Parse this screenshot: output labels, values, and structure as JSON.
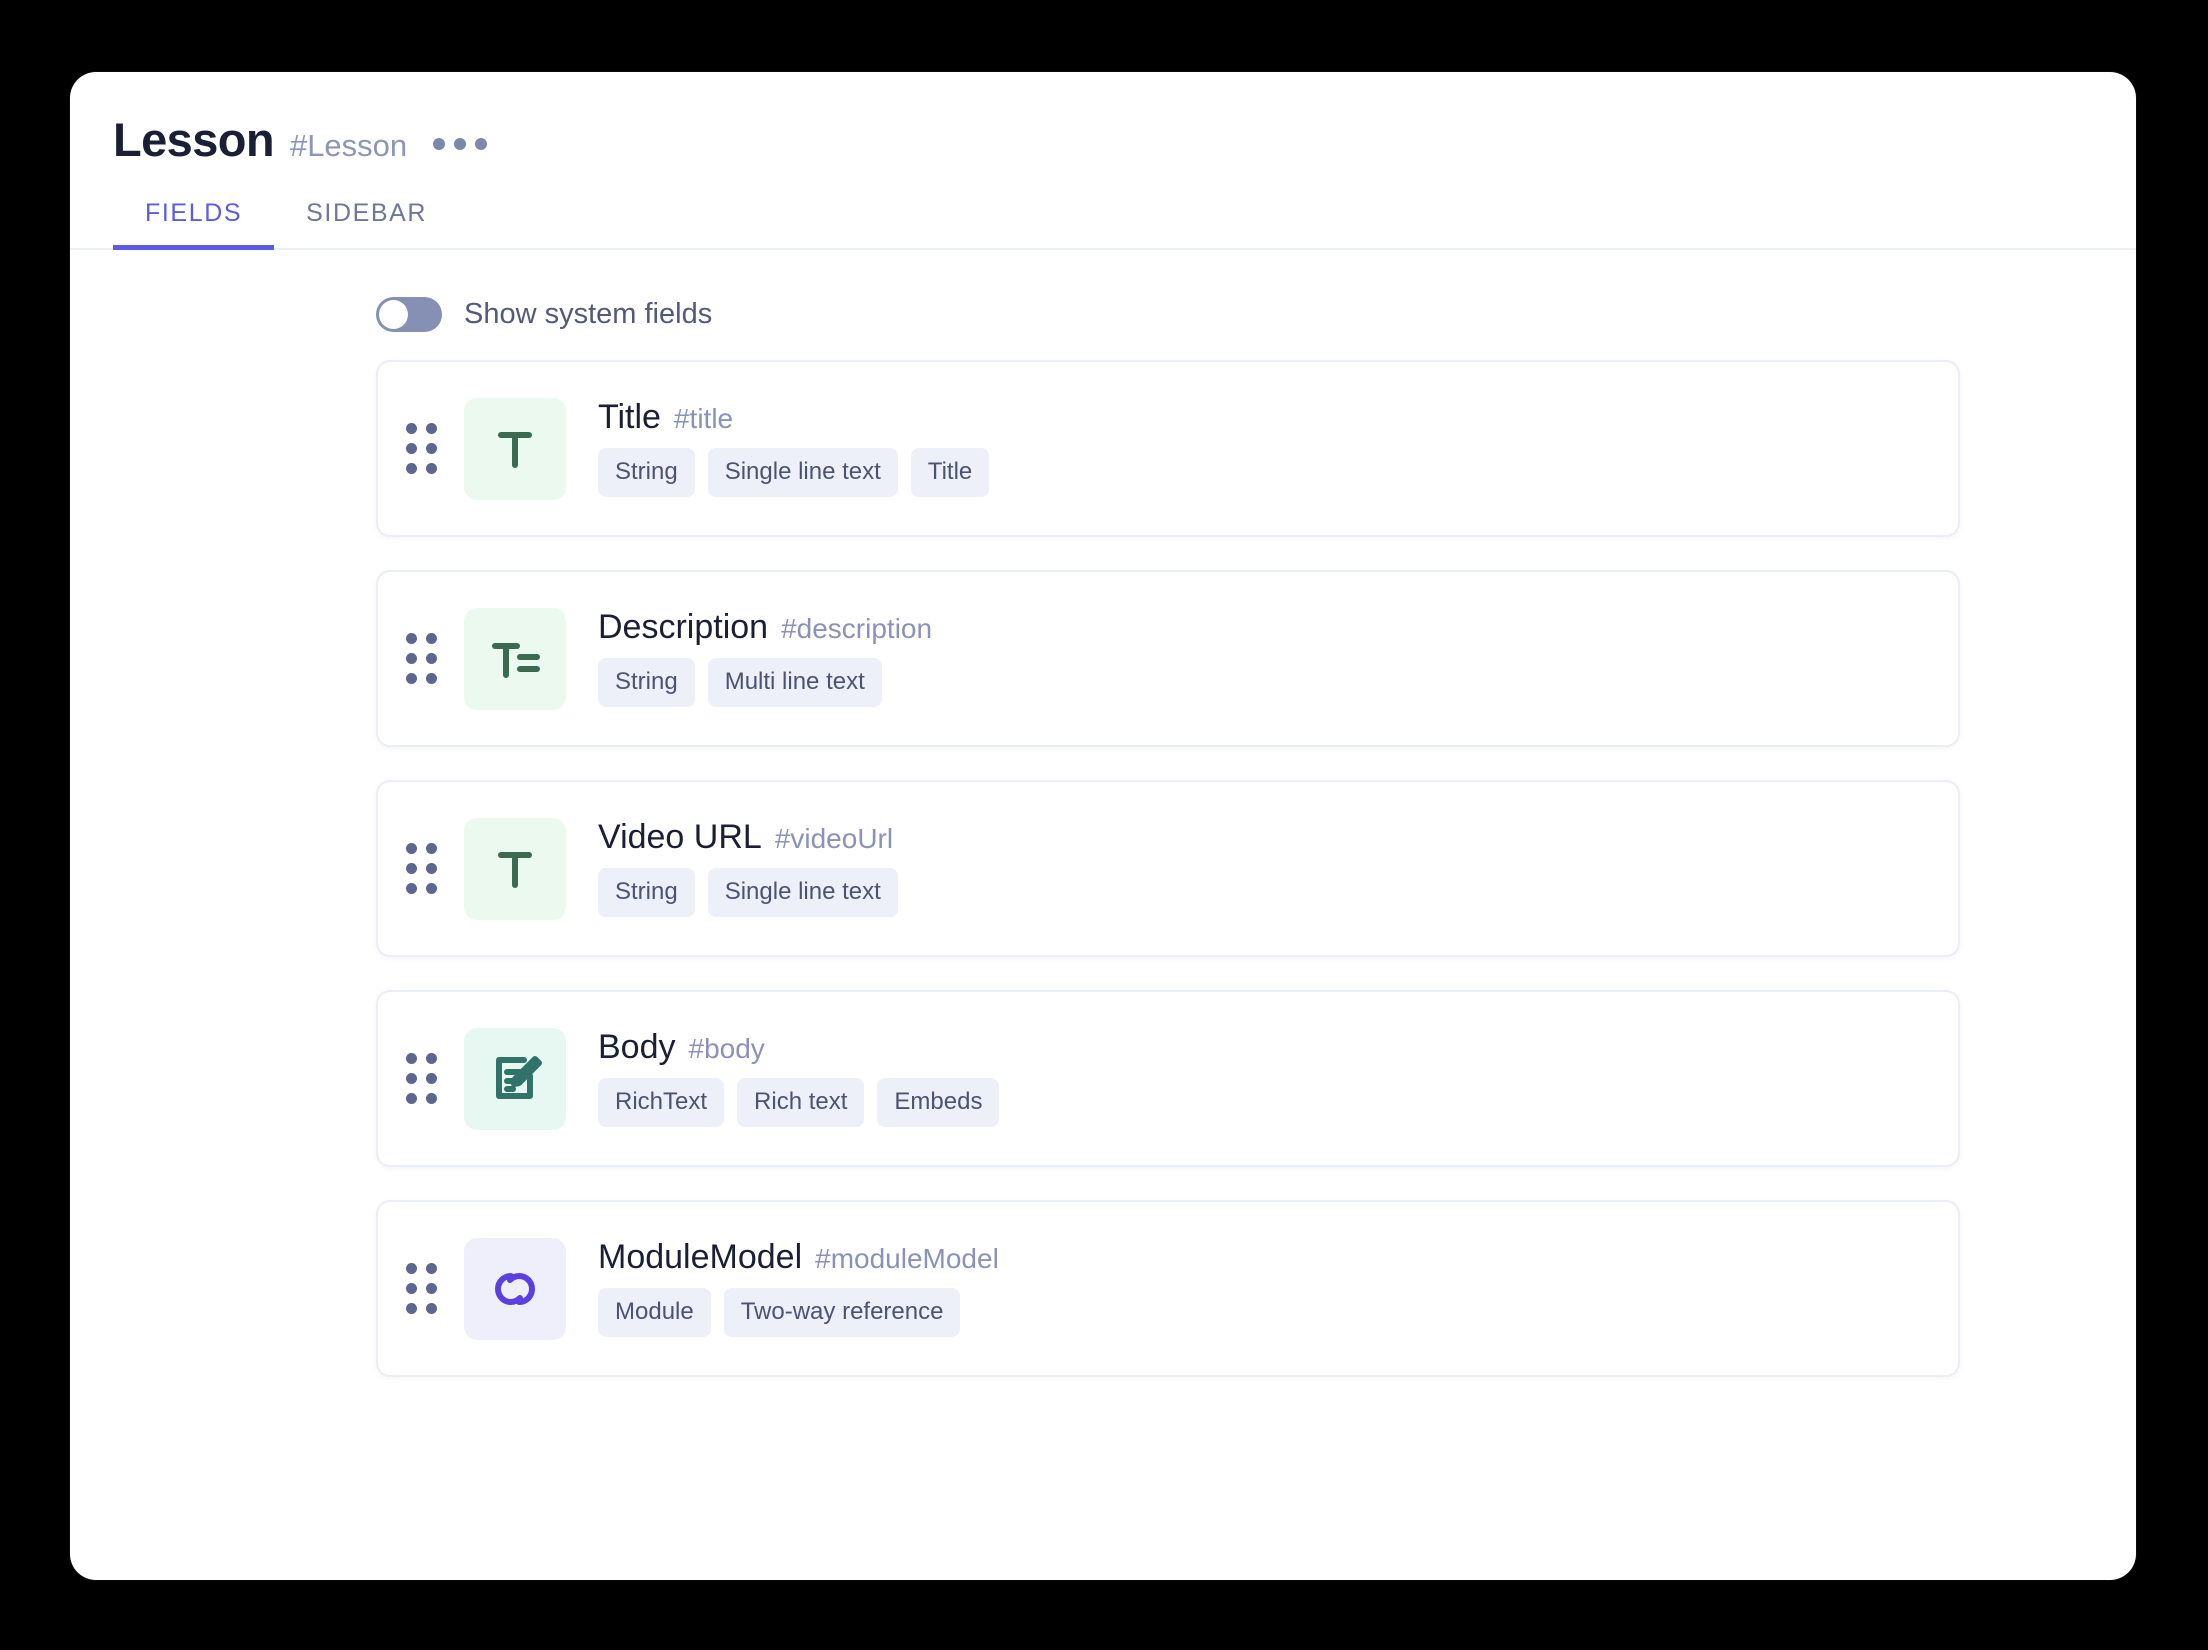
{
  "header": {
    "title": "Lesson",
    "slug": "#Lesson",
    "menu_icon": "kebab-menu-icon"
  },
  "tabs": [
    {
      "label": "FIELDS",
      "active": true
    },
    {
      "label": "SIDEBAR",
      "active": false
    }
  ],
  "controls": {
    "system_fields_toggle": {
      "label": "Show system fields",
      "state": "off"
    }
  },
  "colors": {
    "accent": "#5B5BE8",
    "title": "#1B1F33",
    "slug": "#8A93B6",
    "tag_bg": "#EDEFF9",
    "tag_text": "#4B5371",
    "icon_green_bg": "#EBF9EE",
    "icon_green_fg": "#3A6B50",
    "icon_mint_bg": "#E7F8F3",
    "icon_mint_fg": "#2F7369",
    "icon_purple_bg": "#EFEFFB",
    "icon_purple_fg": "#5B3FE0",
    "background": "#000000",
    "card": "#FFFFFF"
  },
  "fields": [
    {
      "name": "Title",
      "slug": "#title",
      "icon": "text-single-line-icon",
      "icon_theme": "green",
      "tags": [
        "String",
        "Single line text",
        "Title"
      ]
    },
    {
      "name": "Description",
      "slug": "#description",
      "icon": "text-multi-line-icon",
      "icon_theme": "green",
      "tags": [
        "String",
        "Multi line text"
      ]
    },
    {
      "name": "Video URL",
      "slug": "#videoUrl",
      "icon": "text-single-line-icon",
      "icon_theme": "green",
      "tags": [
        "String",
        "Single line text"
      ]
    },
    {
      "name": "Body",
      "slug": "#body",
      "icon": "rich-text-edit-icon",
      "icon_theme": "mint",
      "tags": [
        "RichText",
        "Rich text",
        "Embeds"
      ]
    },
    {
      "name": "ModuleModel",
      "slug": "#moduleModel",
      "icon": "link-reference-icon",
      "icon_theme": "purple",
      "tags": [
        "Module",
        "Two-way reference"
      ]
    }
  ]
}
